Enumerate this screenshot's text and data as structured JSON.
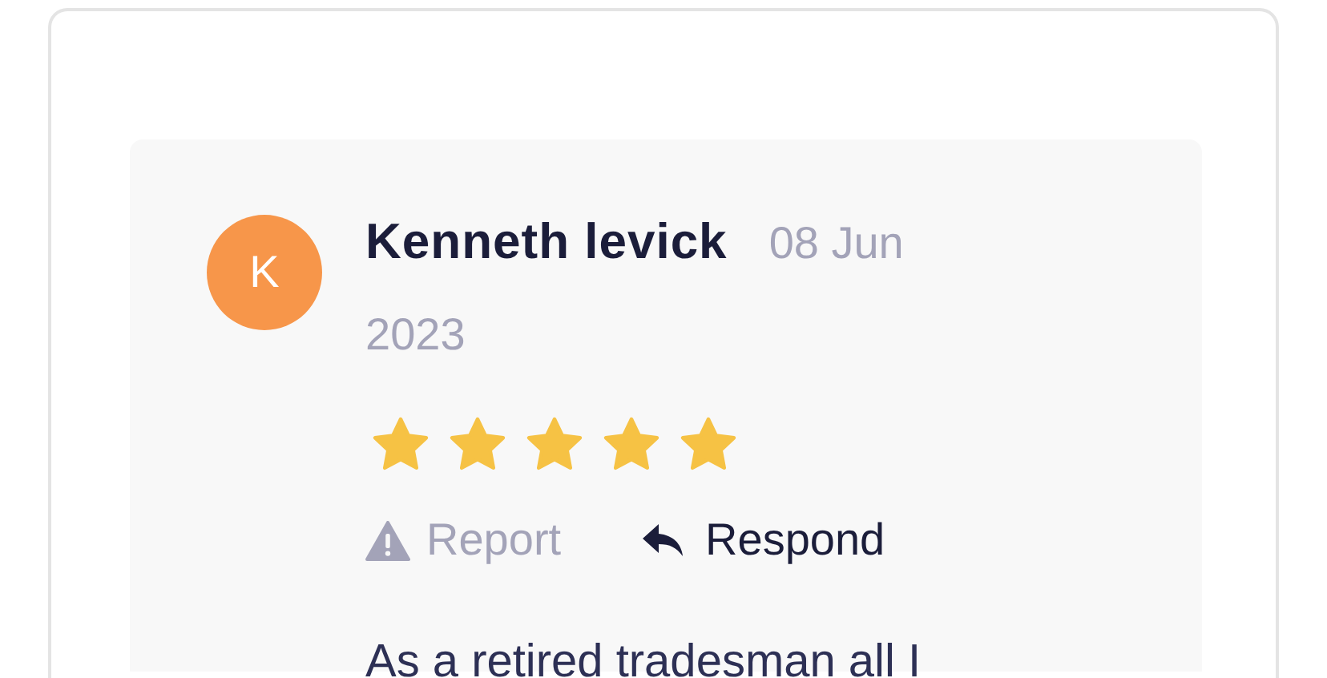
{
  "review": {
    "avatar_letter": "K",
    "author": "Kenneth levick",
    "date": "08 Jun 2023",
    "stars": 5,
    "actions": [
      {
        "kind": "report",
        "label": "Report"
      },
      {
        "kind": "respond",
        "label": "Respond"
      }
    ],
    "text": "As a retired tradesman all I"
  }
}
